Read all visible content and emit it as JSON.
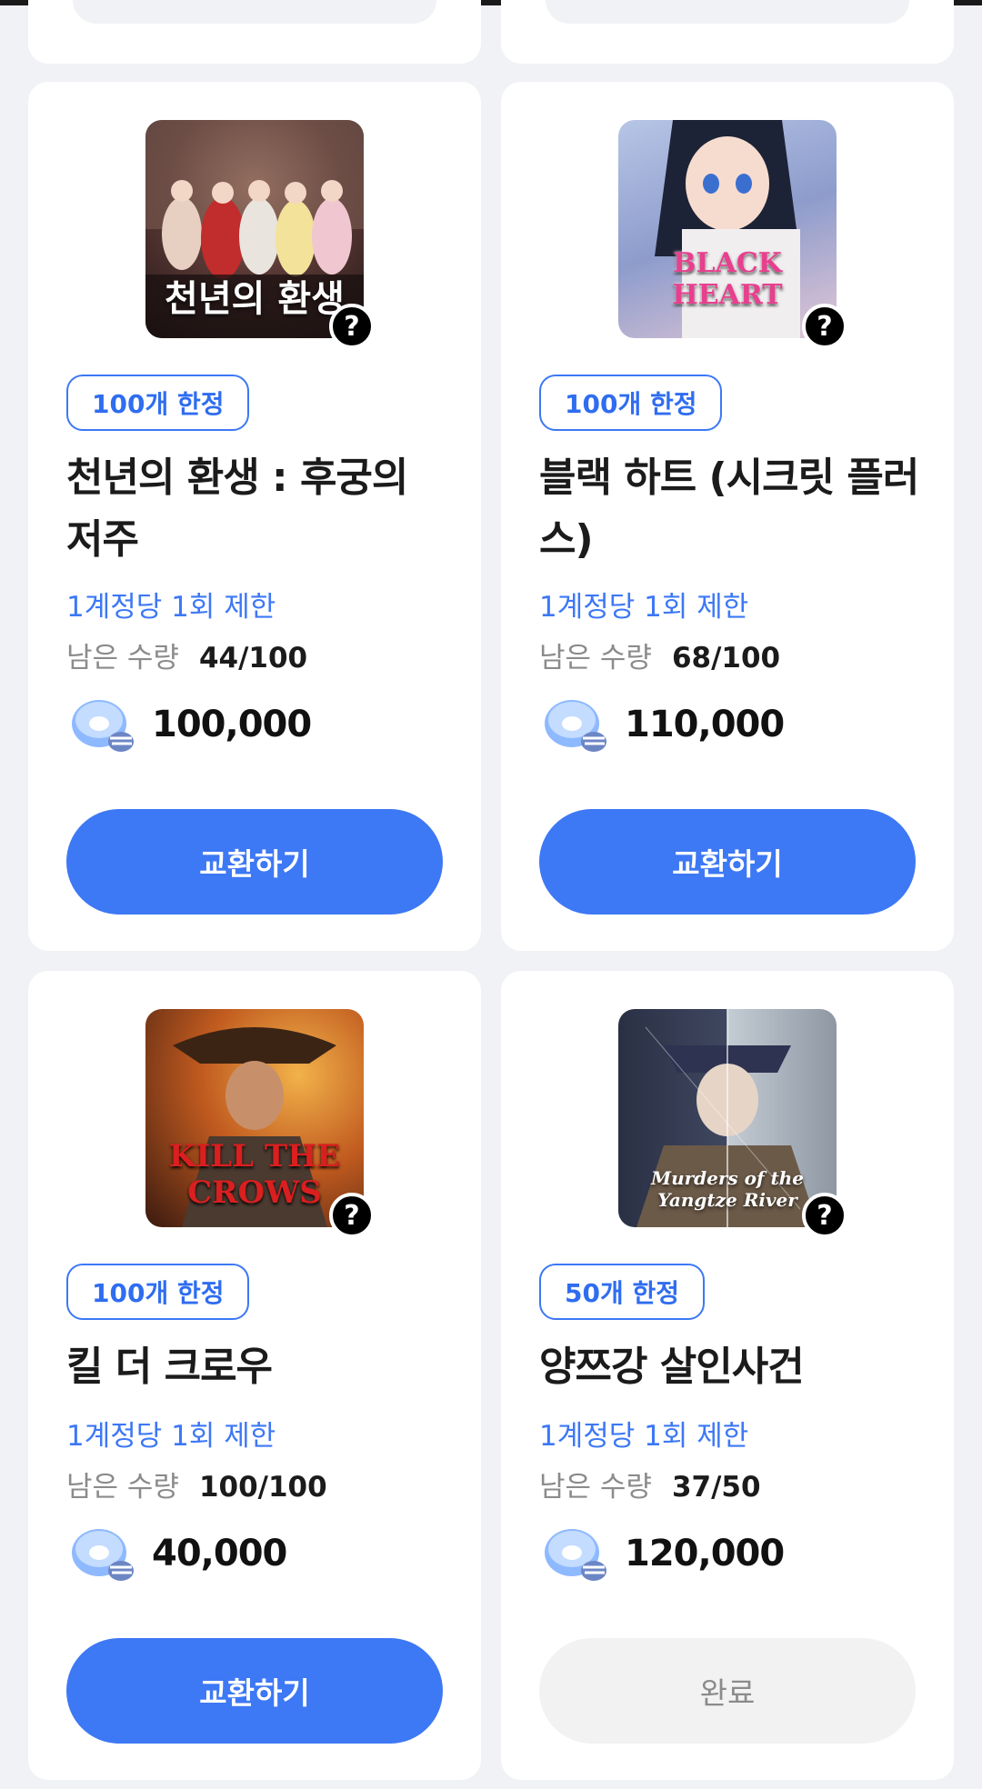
{
  "colors": {
    "accent": "#3d78f5",
    "done_bg": "#f2f2f2",
    "page_bg": "#f1f2f5"
  },
  "items": [
    {
      "thumbnail_text": "천년의 환생",
      "badge": "100개 한정",
      "title": "천년의 환생 : 후궁의 저주",
      "limit": "1계정당 1회 제한",
      "remain_label": "남은 수량",
      "remain_value": "44/100",
      "price": "100,000",
      "button": "교환하기",
      "status": "active"
    },
    {
      "thumbnail_text": "BLACK HEART",
      "badge": "100개 한정",
      "title": "블랙 하트 (시크릿 플러스)",
      "limit": "1계정당 1회 제한",
      "remain_label": "남은 수량",
      "remain_value": "68/100",
      "price": "110,000",
      "button": "교환하기",
      "status": "active"
    },
    {
      "thumbnail_text": "KILL THE CROWS",
      "badge": "100개 한정",
      "title": "킬 더 크로우",
      "limit": "1계정당 1회 제한",
      "remain_label": "남은 수량",
      "remain_value": "100/100",
      "price": "40,000",
      "button": "교환하기",
      "status": "active"
    },
    {
      "thumbnail_text": "Murders of the Yangtze River",
      "badge": "50개 한정",
      "title": "양쯔강 살인사건",
      "limit": "1계정당 1회 제한",
      "remain_label": "남은 수량",
      "remain_value": "37/50",
      "price": "120,000",
      "button": "완료",
      "status": "done"
    }
  ],
  "help_icon": "question-circle-icon",
  "currency_icon": "donut-coin-icon"
}
